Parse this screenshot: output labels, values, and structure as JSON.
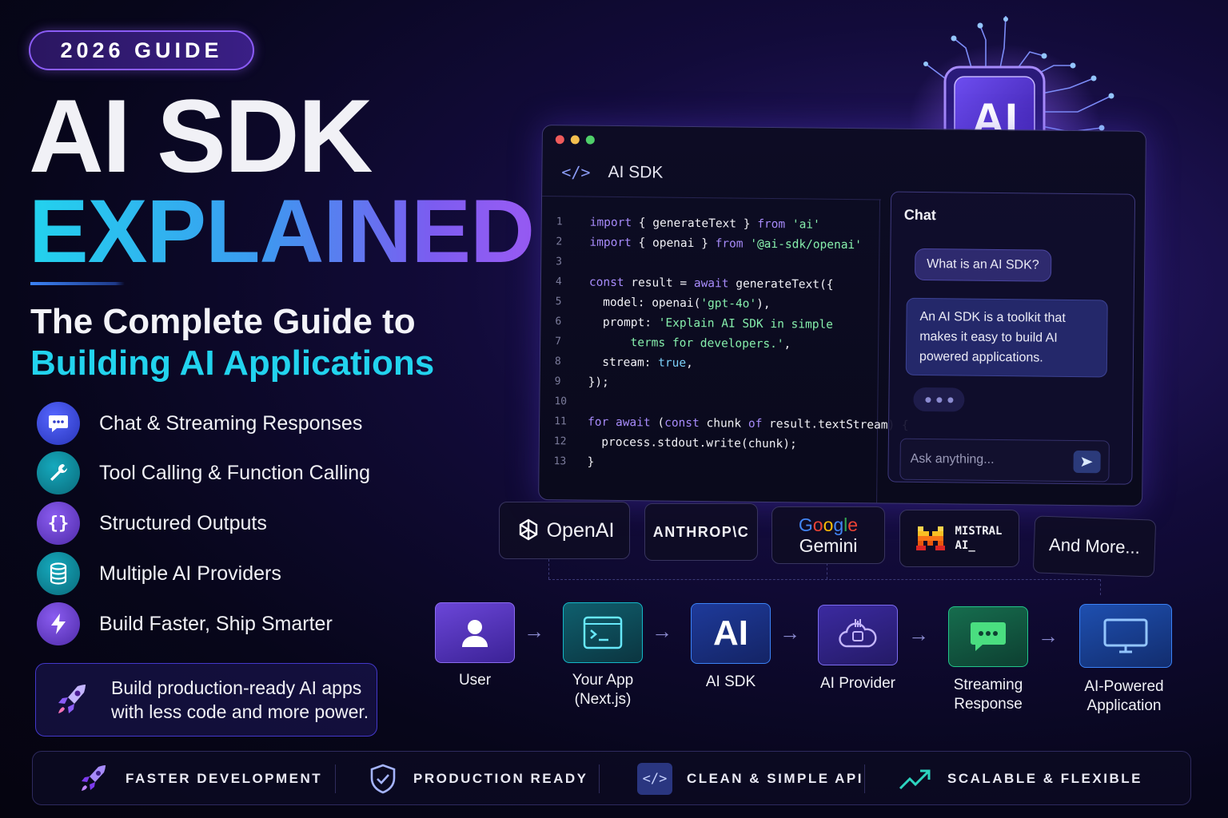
{
  "badge": "2026 GUIDE",
  "title": {
    "line1": "AI SDK",
    "line2": "EXPLAINED"
  },
  "subtitle": {
    "line1": "The Complete Guide to",
    "line2": "Building AI Applications"
  },
  "features": [
    {
      "label": "Chat & Streaming Responses",
      "icon": "chat-bubble-icon",
      "color": "#3b4ee0"
    },
    {
      "label": "Tool Calling & Function Calling",
      "icon": "wrench-icon",
      "color": "#0e8a9c"
    },
    {
      "label": "Structured Outputs",
      "icon": "braces-icon",
      "color": "#6d3fd6"
    },
    {
      "label": "Multiple AI Providers",
      "icon": "database-icon",
      "color": "#0e8a9c"
    },
    {
      "label": "Build Faster, Ship Smarter",
      "icon": "lightning-icon",
      "color": "#6d3fd6"
    }
  ],
  "promo": {
    "line1": "Build production-ready AI apps",
    "line2": "with less code and more power.",
    "icon": "rocket-icon"
  },
  "editor": {
    "title": "AI SDK",
    "code": [
      {
        "n": "1",
        "parts": [
          [
            "kw",
            "import"
          ],
          [
            "fn",
            " { generateText } "
          ],
          [
            "kw",
            "from"
          ],
          [
            "st",
            " 'ai'"
          ]
        ]
      },
      {
        "n": "2",
        "parts": [
          [
            "kw",
            "import"
          ],
          [
            "fn",
            " { openai } "
          ],
          [
            "kw",
            "from"
          ],
          [
            "st",
            " '@ai-sdk/openai'"
          ]
        ]
      },
      {
        "n": "3",
        "parts": []
      },
      {
        "n": "4",
        "parts": [
          [
            "kw",
            "const"
          ],
          [
            "fn",
            " result = "
          ],
          [
            "kw",
            "await"
          ],
          [
            "fn",
            " generateText({"
          ]
        ]
      },
      {
        "n": "5",
        "parts": [
          [
            "fn",
            "  model: openai("
          ],
          [
            "st",
            "'gpt-4o'"
          ],
          [
            "fn",
            "),"
          ]
        ]
      },
      {
        "n": "6",
        "parts": [
          [
            "fn",
            "  prompt: "
          ],
          [
            "st",
            "'Explain AI SDK in simple"
          ]
        ]
      },
      {
        "n": "7",
        "parts": [
          [
            "st",
            "      terms for developers.'"
          ],
          [
            "fn",
            ","
          ]
        ]
      },
      {
        "n": "8",
        "parts": [
          [
            "fn",
            "  stream: "
          ],
          [
            "bl",
            "true"
          ],
          [
            "fn",
            ","
          ]
        ]
      },
      {
        "n": "9",
        "parts": [
          [
            "fn",
            "});"
          ]
        ]
      },
      {
        "n": "10",
        "parts": []
      },
      {
        "n": "11",
        "parts": [
          [
            "kw",
            "for await"
          ],
          [
            "fn",
            " ("
          ],
          [
            "kw",
            "const"
          ],
          [
            "fn",
            " chunk "
          ],
          [
            "kw",
            "of"
          ],
          [
            "fn",
            " result.textStream) {"
          ]
        ]
      },
      {
        "n": "12",
        "parts": [
          [
            "fn",
            "  process.stdout.write(chunk);"
          ]
        ]
      },
      {
        "n": "13",
        "parts": [
          [
            "fn",
            "}"
          ]
        ]
      }
    ]
  },
  "chat": {
    "title": "Chat",
    "question": "What is an AI SDK?",
    "answer": "An AI SDK is a toolkit that makes it easy to build AI powered applications.",
    "input_placeholder": "Ask anything..."
  },
  "chip_label": "AI",
  "providers": [
    {
      "name": "OpenAI",
      "icon": "openai-logo-icon"
    },
    {
      "name": "ANTHROP\\C",
      "icon": ""
    },
    {
      "name_top": "Google",
      "name": "Gemini",
      "icon": ""
    },
    {
      "name": "MISTRAL",
      "name2": "AI_",
      "icon": "mistral-logo-icon"
    },
    {
      "name": "And More...",
      "icon": ""
    }
  ],
  "flow": [
    {
      "label": "User",
      "icon": "user-icon"
    },
    {
      "label": "Your App\n(Next.js)",
      "icon": "terminal-window-icon"
    },
    {
      "label": "AI SDK",
      "icon": "ai-text-icon",
      "text": "AI"
    },
    {
      "label": "AI Provider",
      "icon": "cloud-chip-icon"
    },
    {
      "label": "Streaming\nResponse",
      "icon": "chat-dots-icon"
    },
    {
      "label": "AI-Powered\nApplication",
      "icon": "monitor-icon"
    }
  ],
  "benefits": [
    {
      "label": "FASTER DEVELOPMENT",
      "icon": "rocket-icon"
    },
    {
      "label": "PRODUCTION READY",
      "icon": "shield-check-icon"
    },
    {
      "label": "CLEAN & SIMPLE API",
      "icon": "code-icon"
    },
    {
      "label": "SCALABLE & FLEXIBLE",
      "icon": "trend-up-icon"
    }
  ],
  "colors": {
    "accent_cyan": "#22d3ee",
    "accent_purple": "#8b5cf6",
    "background": "#07061a"
  }
}
